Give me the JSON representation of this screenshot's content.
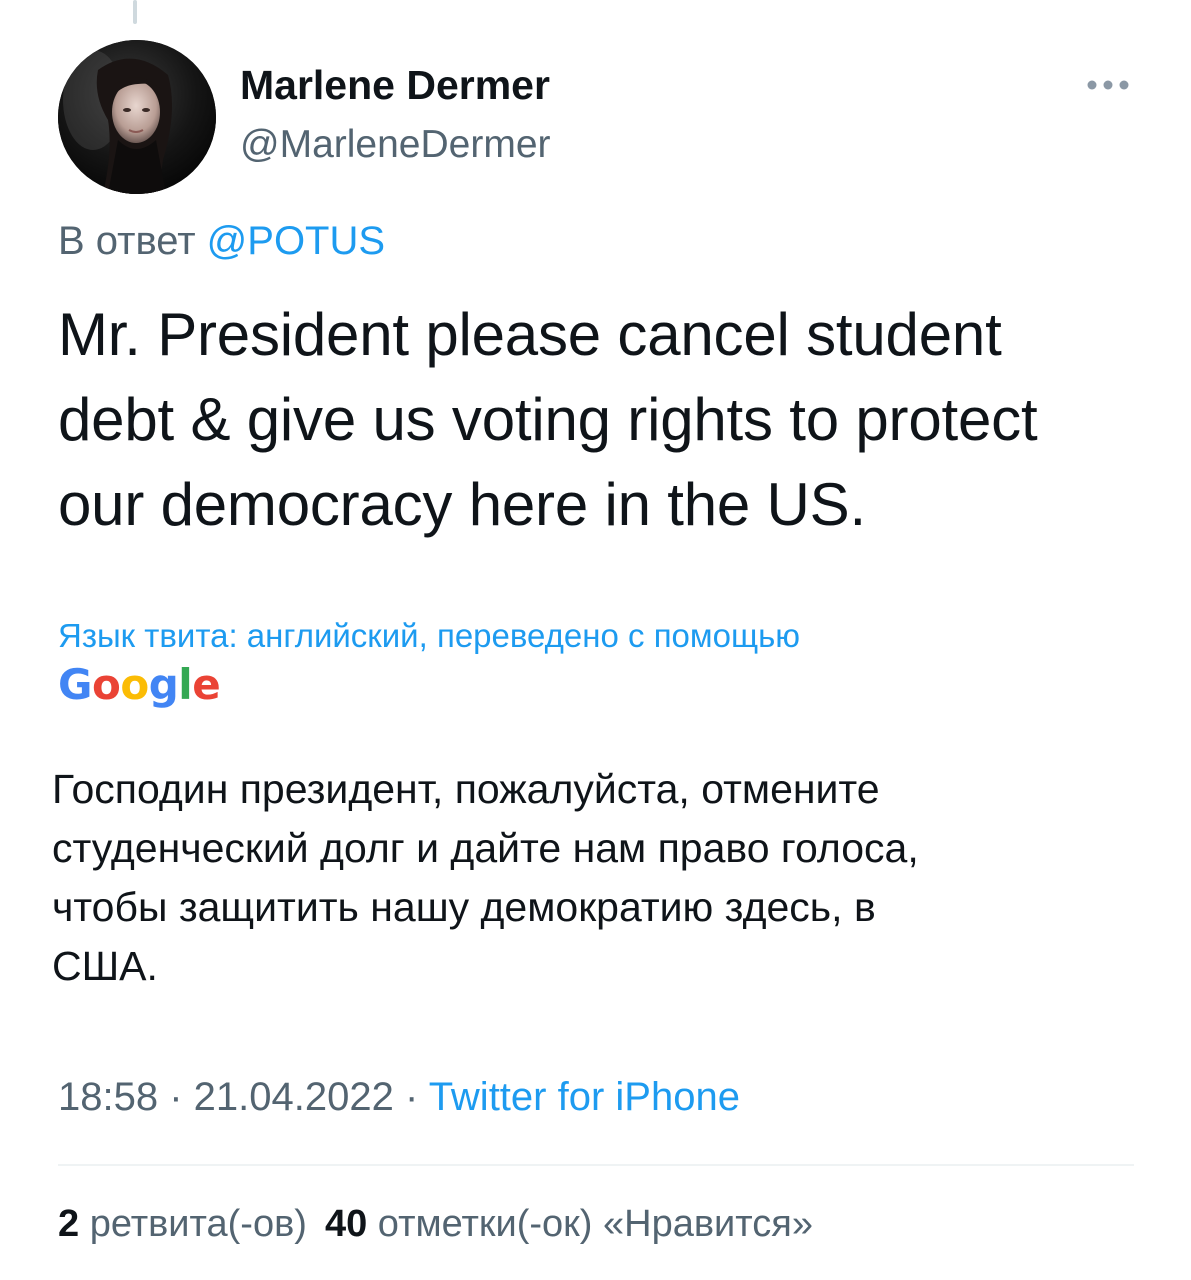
{
  "tweet": {
    "author": {
      "display_name": "Marlene Dermer",
      "handle": "@MarleneDermer"
    },
    "more_icon": "more-horizontal-icon",
    "reply_prefix": "В ответ",
    "reply_mention": "@POTUS",
    "text_lines": [
      "Mr. President please cancel student",
      "debt & give us voting rights to protect",
      "our democracy here in the US."
    ],
    "translation": {
      "notice": "Язык твита: английский, переведено с помощью",
      "provider_letters": [
        "G",
        "o",
        "o",
        "g",
        "l",
        "e"
      ],
      "lines": [
        "Господин президент, пожалуйста, отмените",
        "студенческий долг и дайте нам право голоса,",
        "чтобы защитить нашу демократию здесь, в",
        "США."
      ]
    },
    "time": "18:58",
    "separator": " · ",
    "date": "21.04.2022",
    "source": "Twitter for iPhone",
    "stats": {
      "retweets_count": "2",
      "retweets_label": "ретвита(-ов)",
      "likes_count": "40",
      "likes_label": "отметки(-ок) «Нравится»"
    }
  },
  "colors": {
    "text_primary": "#0f1419",
    "text_secondary": "#536471",
    "accent": "#1d9bf0",
    "divider": "#eff3f4"
  }
}
